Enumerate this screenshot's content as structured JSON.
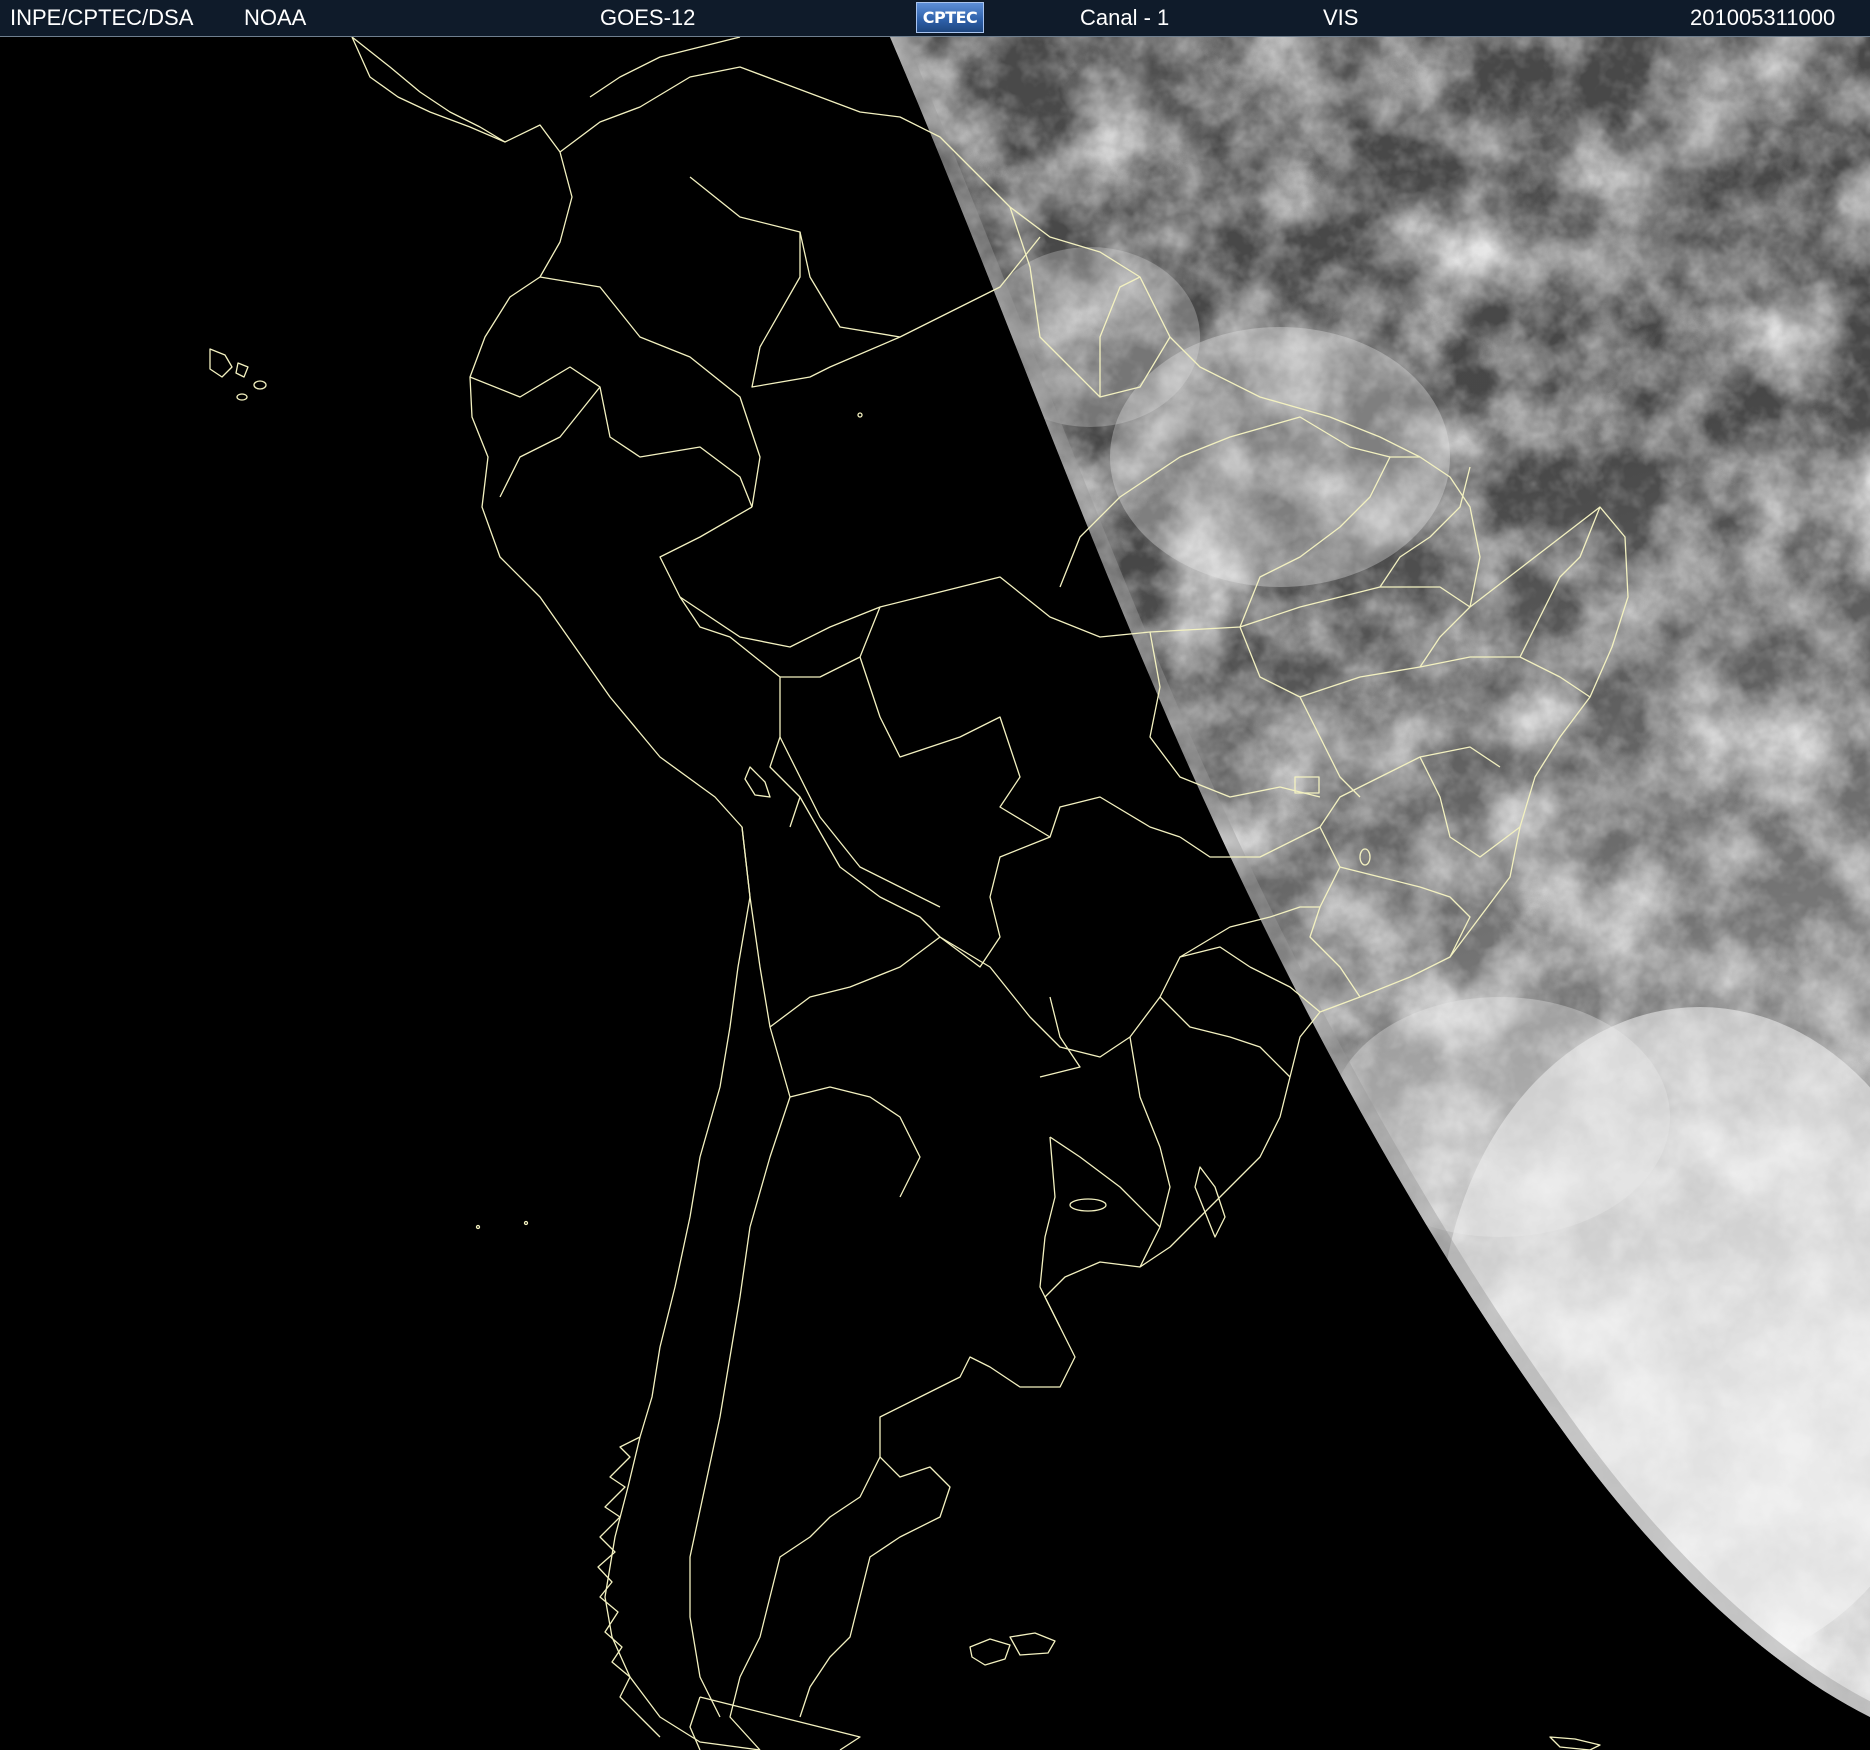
{
  "header": {
    "institution": "INPE/CPTEC/DSA",
    "agency": "NOAA",
    "satellite": "GOES-12",
    "logo_text": "CPTEC",
    "channel": "Canal - 1",
    "band": "VIS",
    "timestamp": "201005311000"
  },
  "colors": {
    "header_background": "#0f1b2a",
    "header_text": "#ffffff",
    "coastline": "#f3f1c0",
    "cloud_bright": "#f4f4f4",
    "cloud_surface_dark": "#3d3d3d",
    "night_side": "#000000"
  },
  "map": {
    "region": "South America",
    "day_side": "east",
    "night_side": "west"
  }
}
